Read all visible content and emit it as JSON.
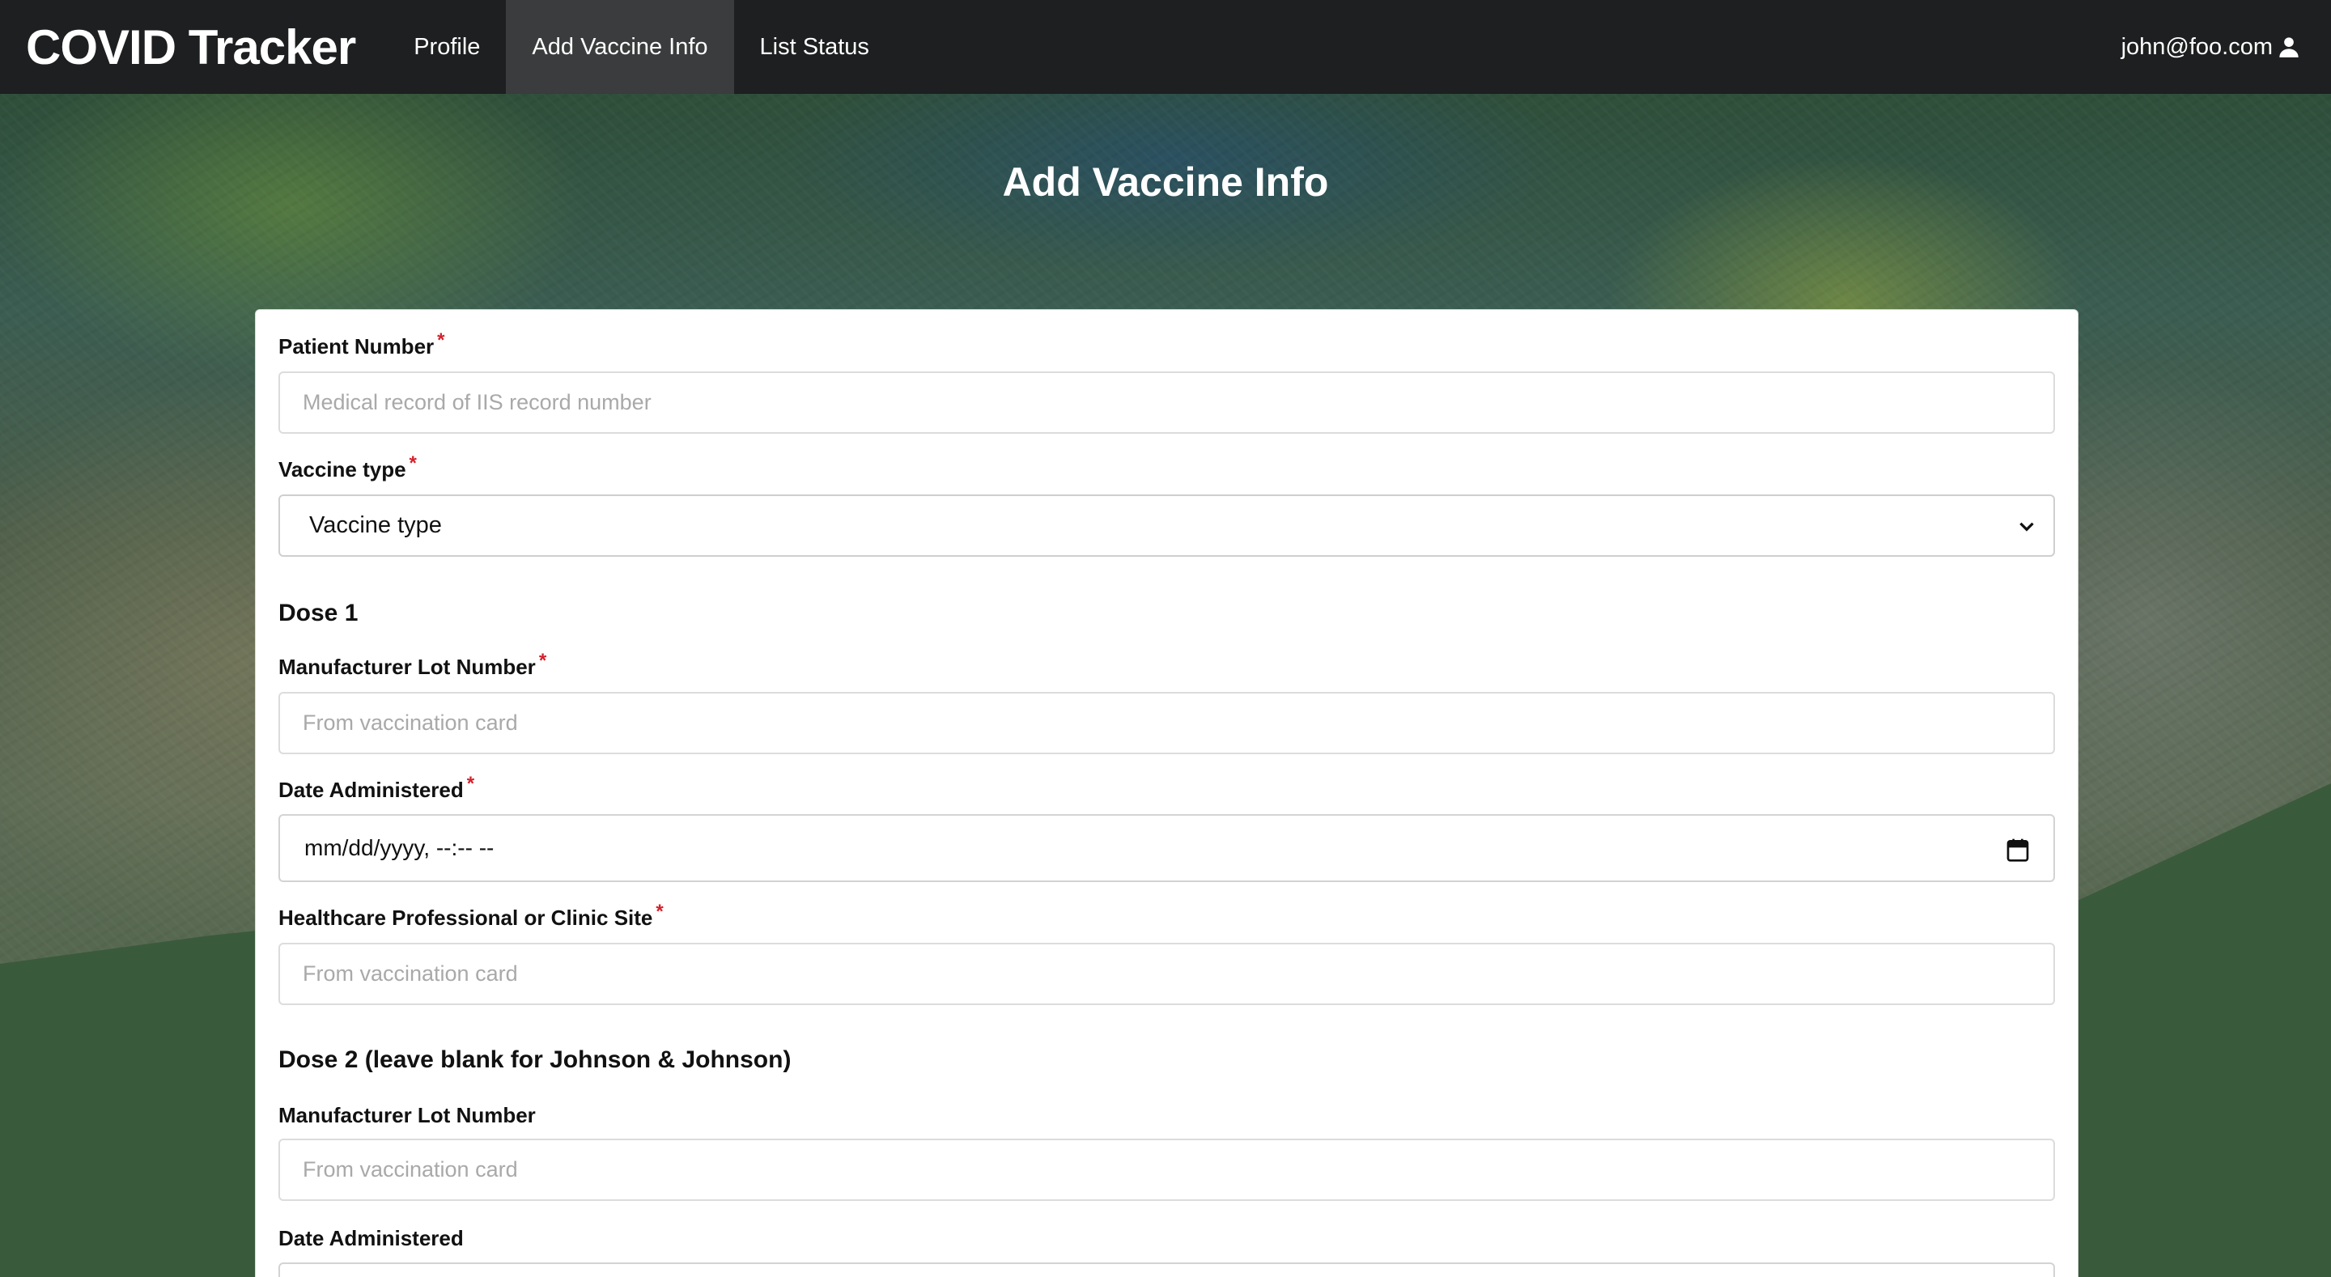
{
  "nav": {
    "brand": "COVID Tracker",
    "items": [
      {
        "label": "Profile",
        "active": false
      },
      {
        "label": "Add Vaccine Info",
        "active": true
      },
      {
        "label": "List Status",
        "active": false
      }
    ],
    "user": "john@foo.com",
    "user_icon": "user-icon"
  },
  "page": {
    "title": "Add Vaccine Info"
  },
  "form": {
    "required_mark": "*",
    "patient_number": {
      "label": "Patient Number",
      "placeholder": "Medical record of IIS record number",
      "value": ""
    },
    "vaccine_type": {
      "label": "Vaccine type",
      "selected": "Vaccine type"
    },
    "dose1": {
      "heading": "Dose 1",
      "lot": {
        "label": "Manufacturer Lot Number",
        "placeholder": "From vaccination card",
        "value": ""
      },
      "date": {
        "label": "Date Administered",
        "display": "mm/dd/yyyy, --:-- --"
      },
      "site": {
        "label": "Healthcare Professional or Clinic Site",
        "placeholder": "From vaccination card",
        "value": ""
      }
    },
    "dose2": {
      "heading": "Dose 2 (leave blank for Johnson & Johnson)",
      "lot": {
        "label": "Manufacturer Lot Number",
        "placeholder": "From vaccination card",
        "value": ""
      },
      "date": {
        "label": "Date Administered"
      }
    }
  },
  "colors": {
    "navbar": "#1d1f20",
    "nav_active": "#3a3c3d",
    "wave_green": "#3a5a3c",
    "required": "#d4202b"
  }
}
